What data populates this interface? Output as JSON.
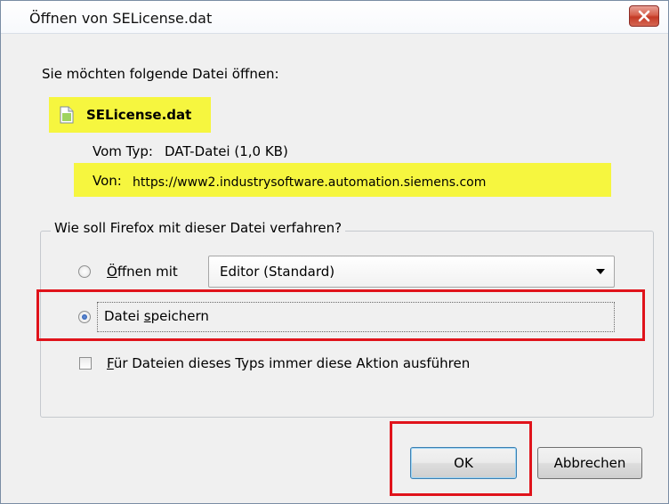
{
  "dialog": {
    "title": "Öffnen von SELicense.dat",
    "prompt": "Sie möchten folgende Datei öffnen:",
    "file_name": "SELicense.dat",
    "type_label": "Vom Typ:",
    "type_value": "DAT-Datei (1,0 KB)",
    "from_label": "Von:",
    "from_value": "https://www2.industrysoftware.automation.siemens.com",
    "icons": {
      "file": "document-icon",
      "close": "close-icon"
    }
  },
  "action_group": {
    "legend": "Wie soll Firefox mit dieser Datei verfahren?",
    "open_with": {
      "mnemonic": "Ö",
      "label_rest": "ffnen mit",
      "selected_app": "Editor (Standard)",
      "checked": false
    },
    "save_file": {
      "label_prefix": "Datei ",
      "mnemonic": "s",
      "label_rest": "peichern",
      "checked": true
    },
    "always_do": {
      "mnemonic": "F",
      "label_rest": "ür Dateien dieses Typs immer diese Aktion ausführen",
      "checked": false
    }
  },
  "buttons": {
    "ok": "OK",
    "cancel": "Abbrechen"
  },
  "colors": {
    "highlight": "#f6f63f",
    "annotation_red": "#e0131b",
    "close_red": "#c43a26"
  }
}
